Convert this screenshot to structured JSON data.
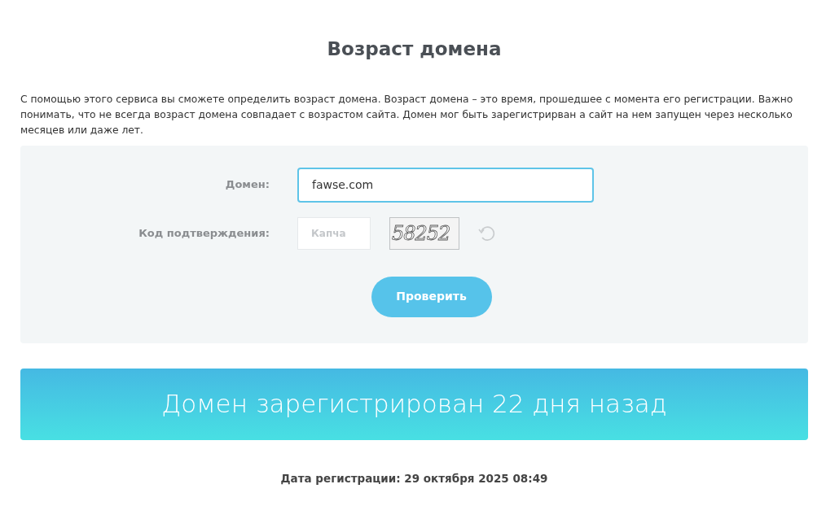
{
  "title": "Возраст домена",
  "description": "С помощью этого сервиса вы сможете определить возраст домена. Возраст домена – это время, прошедшее с момента его регистрации. Важно понимать, что не всегда возраст домена совпадает с возрастом сайта. Домен мог быть зарегистрирван а сайт на нем запущен через несколько месяцев или даже лет.",
  "form": {
    "domain_label": "Домен:",
    "domain_value": "fawse.com",
    "domain_focused": true,
    "captcha_label": "Код подтверждения:",
    "captcha_placeholder": "Капча",
    "captcha_code": "58252",
    "submit": "Проверить"
  },
  "result": "Домен зарегистрирован 22 дня назад",
  "registration": "Дата регистрации: 29 октября 2025 08:49"
}
